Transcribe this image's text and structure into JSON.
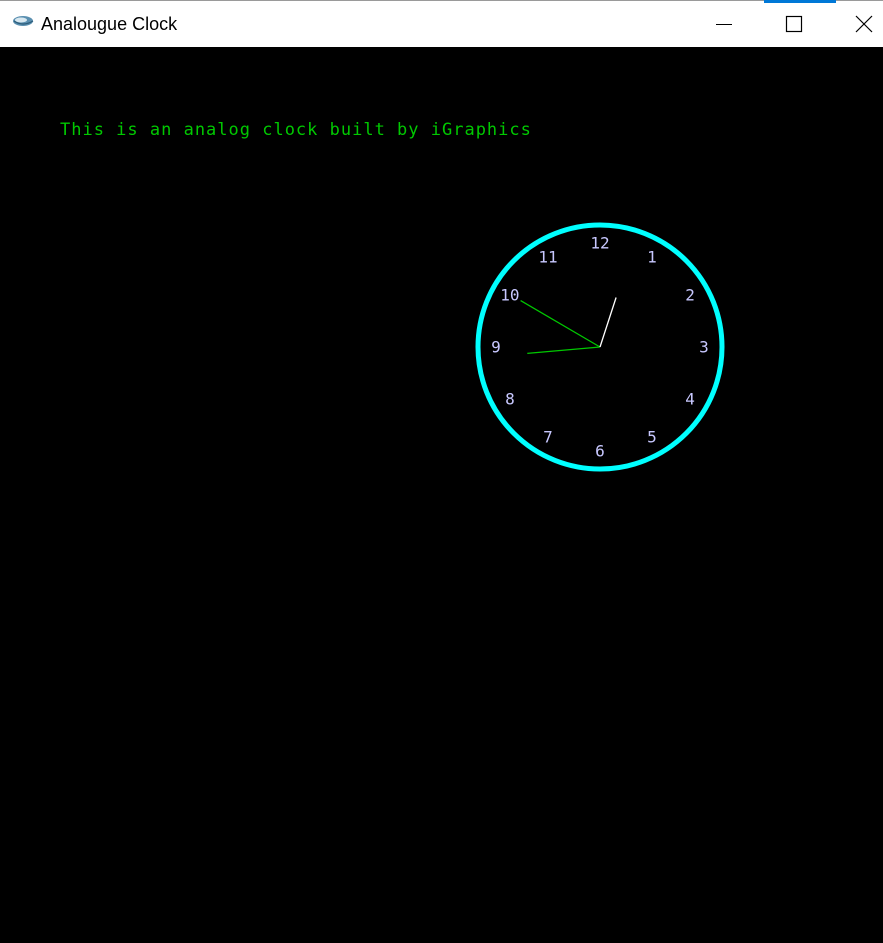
{
  "window": {
    "title": "Analougue Clock",
    "icon": "app-icon",
    "controls": {
      "minimize": "minimize-icon",
      "maximize": "maximize-icon",
      "close": "close-icon"
    },
    "accent_color": "#0078d7"
  },
  "canvas": {
    "background": "#000000",
    "caption": "This is an analog clock built by iGraphics",
    "caption_color": "#00c800"
  },
  "clock": {
    "ring_color": "#00ffff",
    "numeral_color": "#c8c8ff",
    "numerals": [
      "12",
      "1",
      "2",
      "3",
      "4",
      "5",
      "6",
      "7",
      "8",
      "9",
      "10",
      "11"
    ],
    "time_shown": {
      "hour": 8,
      "minute": 50,
      "second": 3
    },
    "hour_hand_color": "#00c800",
    "minute_hand_color": "#00c800",
    "second_hand_color": "#ffffff"
  }
}
